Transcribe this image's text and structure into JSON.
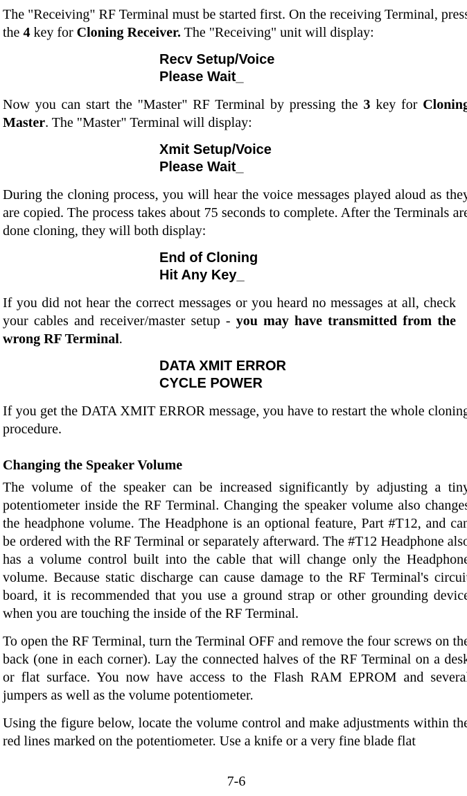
{
  "p1_a": "The \"Receiving\" RF Terminal must be started first.  On the receiving Terminal, press the ",
  "p1_b": "4",
  "p1_c": " key for ",
  "p1_d": "Cloning Receiver.",
  "p1_e": "  The \"Receiving\" unit will display:",
  "display1_l1": "Recv Setup/Voice",
  "display1_l2": "Please Wait_",
  "p2_a": "Now you can start the \"Master\" RF Terminal by pressing the ",
  "p2_b": "3",
  "p2_c": " key for ",
  "p2_d": "Cloning Master",
  "p2_e": ".  The \"Master\" Terminal will display:",
  "display2_l1": "Xmit Setup/Voice",
  "display2_l2": "Please Wait_",
  "p3": "During the cloning process, you will hear the voice messages played aloud as they are copied.  The process takes about 75 seconds to complete. After the Terminals are done cloning, they will both display:",
  "display3_l1": "End of Cloning",
  "display3_l2": "Hit Any Key_",
  "p4_a": "If you did not hear the correct messages or you heard no messages at all, check your cables and receiver/master setup - ",
  "p4_b": "you may have transmitted from the wrong RF Terminal",
  "p4_c": ".",
  "display4_l1": "DATA XMIT ERROR",
  "display4_l2": "CYCLE POWER",
  "p5": "If you get the DATA XMIT ERROR message, you have to restart the whole cloning procedure.",
  "heading": "Changing the Speaker Volume",
  "p6": "The volume of the speaker can be increased significantly by adjusting a tiny potentiometer inside the RF Terminal.  Changing the speaker volume also changes the headphone volume.  The Headphone is an optional feature, Part #T12, and can be ordered with the RF Terminal or separately afterward.  The #T12 Headphone also has a volume control built into the cable that will change only the Headphone volume. Because static discharge can cause damage to the RF Terminal's circuit board, it is recommended that you use a ground strap or other grounding device when you are touching the inside of the RF Terminal.",
  "p7": "To open the RF Terminal, turn the Terminal OFF and remove the four screws on the back  (one in each corner). Lay the connected halves of the RF Terminal on a desk or flat surface. You now have access to the Flash RAM EPROM and several jumpers as well as the volume potentiometer.",
  "p8": "Using the figure below, locate the volume control and make adjustments within the red lines marked on the potentiometer. Use a knife or a very fine blade flat",
  "page_number": "7-6"
}
